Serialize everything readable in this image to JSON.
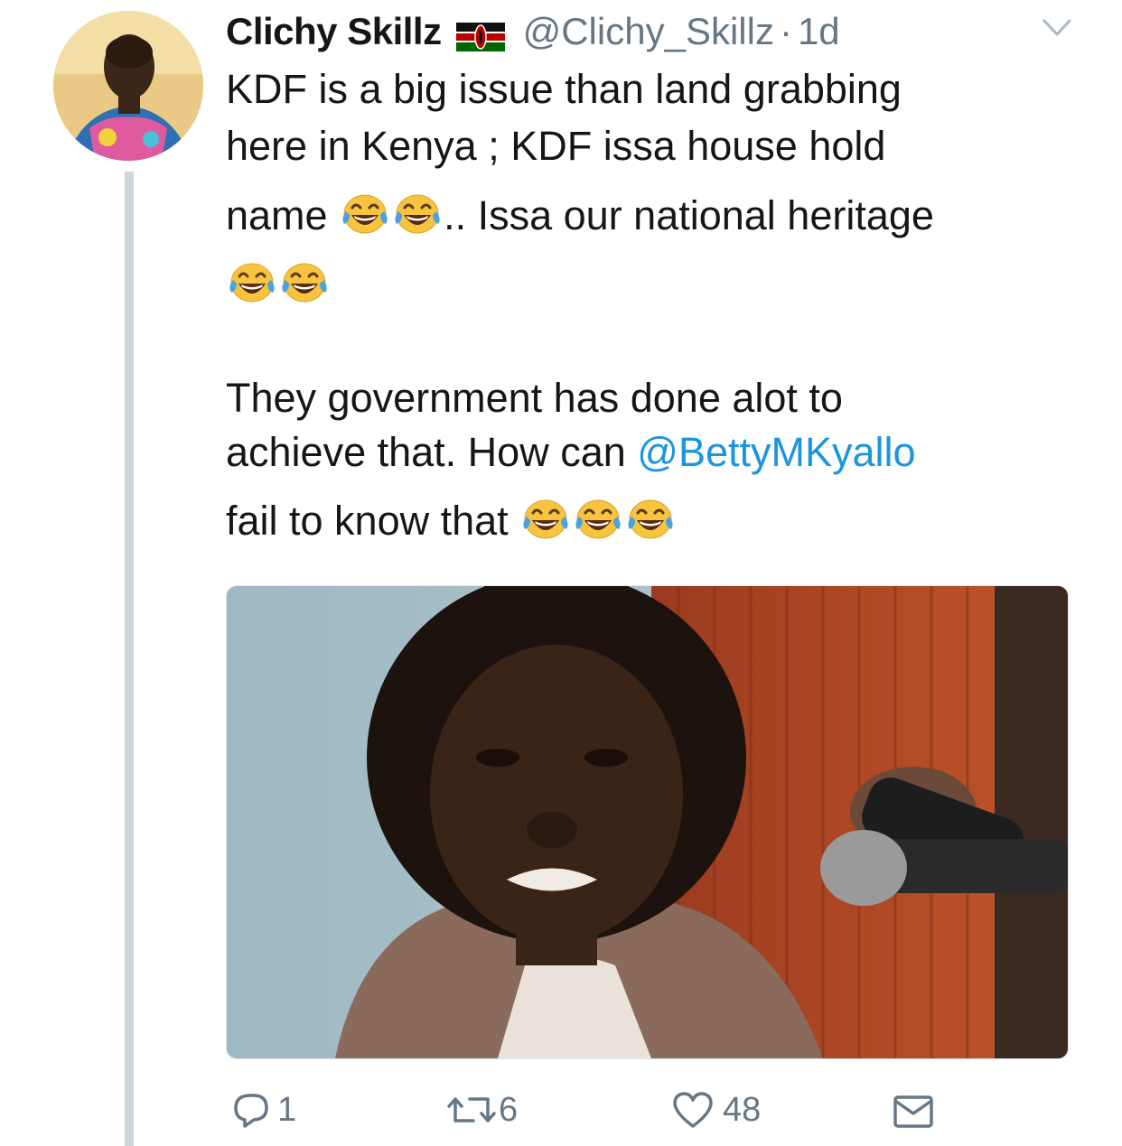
{
  "tweet": {
    "author_name": "Clichy Skillz",
    "author_flag": "kenya-flag",
    "handle": "@Clichy_Skillz",
    "separator": "·",
    "time": "1d",
    "lines": {
      "l1": "KDF is a big issue than land grabbing",
      "l2": "here in Kenya ; KDF issa house hold",
      "l3_a": "name",
      "l3_b": ".. Issa our national heritage",
      "l5": "They government has done alot to",
      "l6_a": "achieve that.  How can",
      "l6_mention": "@BettyMKyallo",
      "l7": "fail to know that"
    },
    "emoji_name": "face-with-tears-of-joy"
  },
  "actions": {
    "reply_count": "1",
    "retweet_count": "6",
    "like_count": "48"
  },
  "colors": {
    "text": "#14171a",
    "muted": "#657786",
    "link": "#1b95e0",
    "thread_line": "#ccd6dd"
  }
}
